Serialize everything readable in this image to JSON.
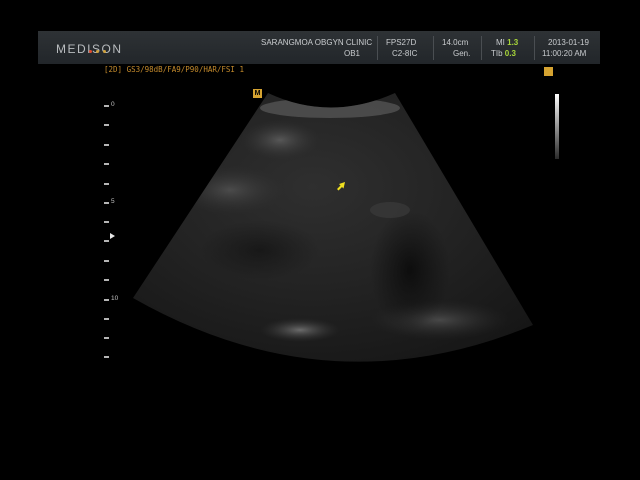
{
  "header": {
    "brand": "MEDISON",
    "brand_dot_colors": [
      "#e04b2e",
      "#d0a13b",
      "#d0a13b"
    ],
    "clinic": "SARANGMOA OBGYN CLINIC",
    "exam": "OB1",
    "fps": "FPS27D",
    "probe": "C2-8IC",
    "depth": "14.0cm",
    "preset": "Gen.",
    "mi_label": "MI",
    "mi_value": "1.3",
    "tib_label": "TIb",
    "tib_value": "0.3",
    "date": "2013-01-19",
    "time": "11:00:20 AM"
  },
  "imaging": {
    "params": "[2D] GS3/98dB/FA9/P90/HAR/FSI 1",
    "orientation_marker": "M",
    "depth_labels": [
      "0",
      "5",
      "10"
    ]
  },
  "colors": {
    "accent_orange": "#c58b2c",
    "value_green": "#a8d63a",
    "marker_yellow": "#d5a331",
    "cursor_yellow": "#f0e020"
  },
  "icons": {
    "cursor": "arrow-cursor-icon",
    "focus": "focus-marker-icon"
  }
}
